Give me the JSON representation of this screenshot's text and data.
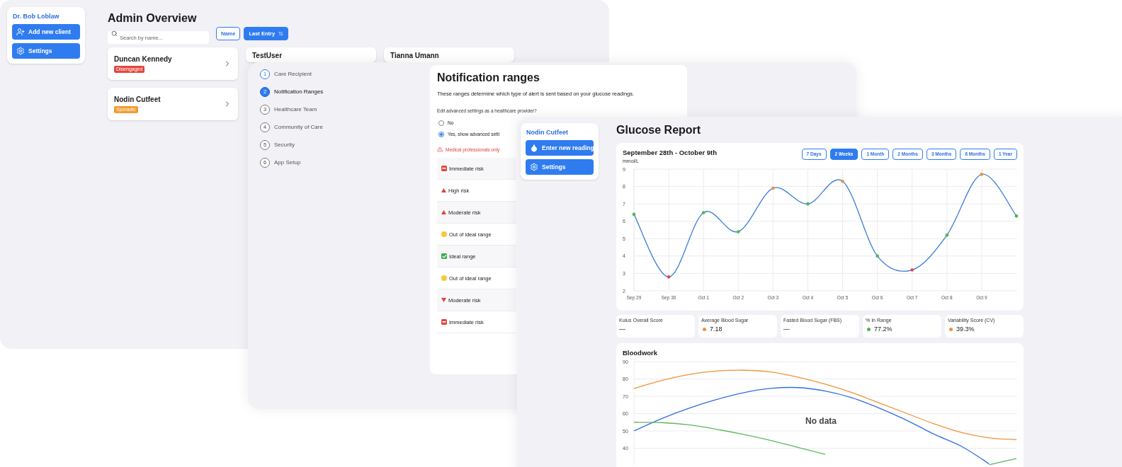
{
  "admin": {
    "doctor": "Dr. Bob Loblaw",
    "actions": [
      {
        "label": "Add new client",
        "kind": "user-plus"
      },
      {
        "label": "Settings",
        "kind": "gear"
      }
    ],
    "title": "Admin Overview",
    "search": {
      "placeholder": "Search by name..."
    },
    "sort_buttons": [
      {
        "label": "Name",
        "selected": false,
        "sortable": false
      },
      {
        "label": "Last Entry",
        "selected": true,
        "sortable": true
      }
    ],
    "clients": [
      {
        "name": "Duncan Kennedy",
        "status": "Disengaged",
        "color": "#e0483e"
      },
      {
        "name": "TestUser"
      },
      {
        "name": "Tianna Umann"
      },
      {
        "name": "Nodin Cutfeet",
        "status": "Sporadic",
        "color": "#f39a2f"
      }
    ]
  },
  "setup": {
    "steps": [
      {
        "number": "1",
        "label": "Care Recipient",
        "selected": false,
        "completed": true
      },
      {
        "number": "2",
        "label": "Notification Ranges",
        "selected": true,
        "completed": false
      },
      {
        "number": "3",
        "label": "Healthcare Team",
        "selected": false,
        "completed": false
      },
      {
        "number": "4",
        "label": "Community of Care",
        "selected": false,
        "completed": false
      },
      {
        "number": "5",
        "label": "Security",
        "selected": false,
        "completed": false
      },
      {
        "number": "6",
        "label": "App Setup",
        "selected": false,
        "completed": false
      }
    ],
    "title": "Notification ranges",
    "description": "These ranges determine which type of alert is sent based on your glucose readings.",
    "question": "Edit advanced settings as a healthcare provider?",
    "options": [
      {
        "label": "No",
        "selected": false
      },
      {
        "label": "Yes, show advanced setti",
        "selected": true
      }
    ],
    "warning": "Medical professionals only",
    "ranges": [
      {
        "label": "Immediate risk",
        "kind": "sos"
      },
      {
        "label": "High risk",
        "kind": "up"
      },
      {
        "label": "Moderate risk",
        "kind": "up"
      },
      {
        "label": "Out of ideal range",
        "kind": "caution"
      },
      {
        "label": "Ideal range",
        "kind": "check"
      },
      {
        "label": "Out of ideal range",
        "kind": "caution"
      },
      {
        "label": "Moderate risk",
        "kind": "down"
      },
      {
        "label": "Immediate risk",
        "kind": "sos"
      }
    ]
  },
  "glucose": {
    "patient": {
      "name": "Nodin Cutfeet",
      "actions": [
        {
          "label": "Enter new reading",
          "kind": "drop"
        },
        {
          "label": "Settings",
          "kind": "gear"
        }
      ]
    },
    "title": "Glucose Report",
    "chart": {
      "title": "September 28th - October 9th",
      "periods": [
        {
          "label": "7 Days",
          "selected": false
        },
        {
          "label": "2 Weeks",
          "selected": true
        },
        {
          "label": "1 Month",
          "selected": false
        },
        {
          "label": "2 Months",
          "selected": false
        },
        {
          "label": "3 Months",
          "selected": false
        },
        {
          "label": "6 Months",
          "selected": false
        },
        {
          "label": "1 Year",
          "selected": false
        }
      ],
      "chart_data": {
        "type": "line",
        "ylabel": "mmol/L",
        "categories": [
          "Sep 29",
          "Sep 30",
          "Oct 1",
          "Oct 2",
          "Oct 3",
          "Oct 4",
          "Oct 5",
          "Oct 6",
          "Oct 7",
          "Oct 8",
          "Oct 9",
          null
        ],
        "series": [
          {
            "color": "#3b7dd8",
            "values": [
              6.4,
              2.8,
              6.5,
              5.4,
              7.9,
              7.0,
              8.3,
              4.0,
              3.2,
              5.2,
              8.7,
              6.3
            ]
          }
        ],
        "ylim": [
          2,
          9
        ],
        "yticks": [
          2,
          3,
          4,
          5,
          6,
          7,
          8,
          9
        ],
        "grid": true
      }
    },
    "stats": [
      {
        "label": "Kulus Overall Score",
        "value": "—"
      },
      {
        "label": "Average Blood Sugar",
        "value": "7.18",
        "color": "#f0923a"
      },
      {
        "label": "Fasted Blood Sugar (FBS)",
        "value": "—"
      },
      {
        "label": "% In Range",
        "value": "77.2%",
        "color": "#4cb84c"
      },
      {
        "label": "Variability Score (CV)",
        "value": "39.3%",
        "color": "#f0923a"
      }
    ],
    "bloodwork": {
      "title": "Bloodwork",
      "message": "No data",
      "chart_data": {
        "type": "line",
        "categories": [
          null,
          null,
          null,
          null,
          null,
          null,
          null,
          null,
          null,
          null,
          null,
          null,
          null,
          null,
          null
        ],
        "series": [
          {
            "color": "#f0923a",
            "values": [
              74.5,
              79,
              82.5,
              84.5,
              85,
              84,
              81,
              77,
              72,
              66,
              60,
              54,
              49,
              46,
              45
            ]
          },
          {
            "color": "#2f6fdf",
            "values": [
              50,
              57,
              63,
              68,
              72,
              74.5,
              75,
              73,
              69,
              63,
              56,
              48,
              41,
              31,
              null
            ]
          },
          {
            "color": "#5cb85c",
            "values": [
              55,
              54.8,
              53.5,
              51,
              48,
              44.5,
              40.5,
              36.5,
              null,
              null,
              null,
              null,
              null,
              30.5,
              34
            ]
          }
        ],
        "ylim": [
          30,
          90
        ],
        "yticks": [
          40,
          50,
          60,
          70,
          80,
          90
        ],
        "grid": true
      }
    }
  }
}
